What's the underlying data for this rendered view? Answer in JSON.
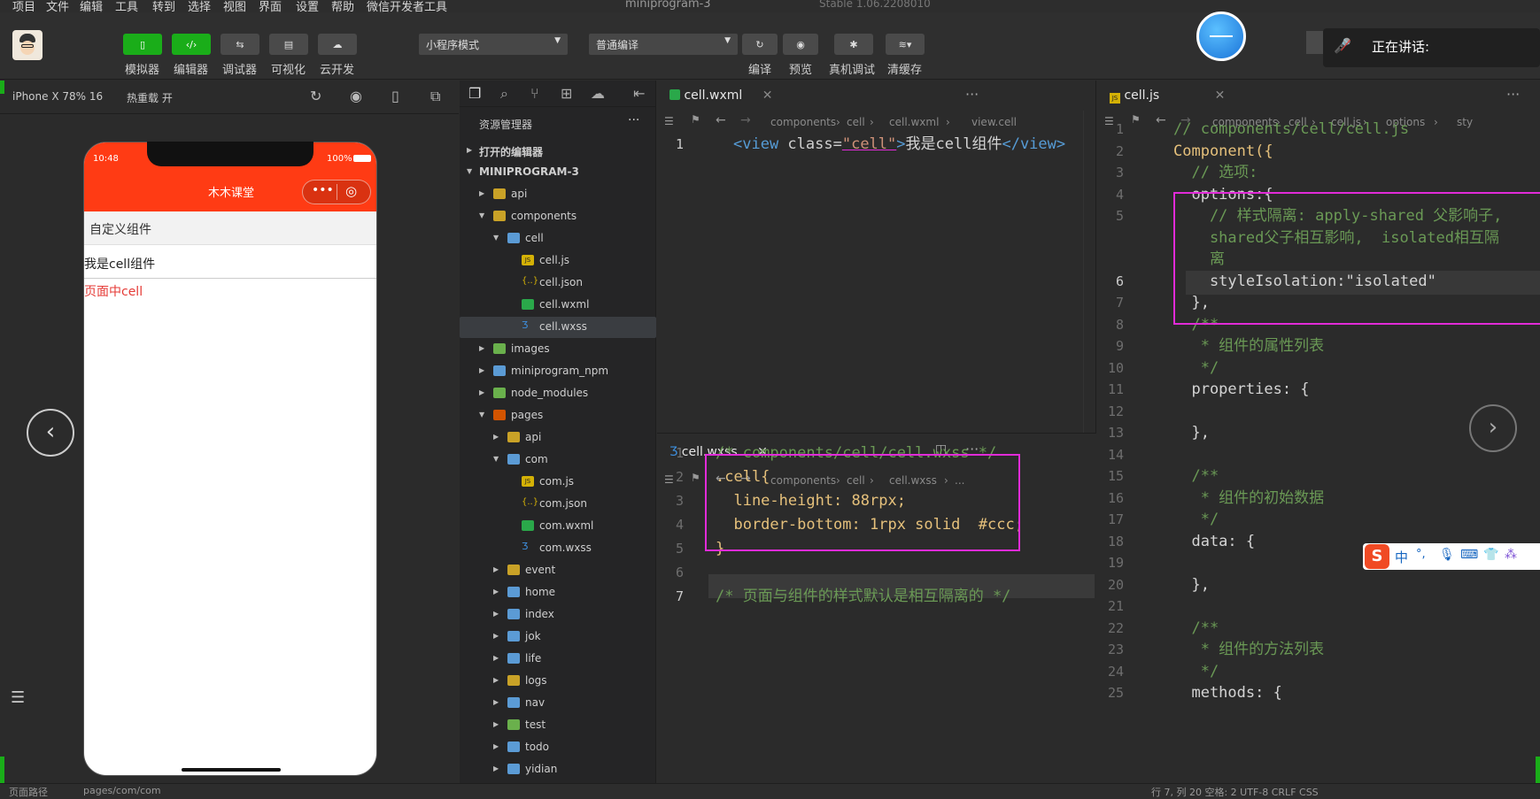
{
  "menu": [
    "项目",
    "文件",
    "编辑",
    "工具",
    "转到",
    "选择",
    "视图",
    "界面",
    "设置",
    "帮助",
    "微信开发者工具"
  ],
  "window_title": "miniprogram-3",
  "version_text": "Stable 1.06.2208010",
  "toolbar": {
    "buttons": [
      "模拟器",
      "编辑器",
      "调试器",
      "可视化",
      "云开发"
    ],
    "mode_select": "小程序模式",
    "compile_select": "普通编译",
    "actions": [
      "编译",
      "预览",
      "真机调试",
      "清缓存"
    ]
  },
  "speaking_label": "正在讲话:",
  "sim": {
    "device": "iPhone X 78% 16",
    "hot_reload": "热重载 开",
    "time": "10:48",
    "battery": "100%",
    "nav_title": "木木课堂",
    "row1": "自定义组件",
    "row2": "我是cell组件",
    "row3": "页面中cell"
  },
  "explorer": {
    "title": "资源管理器",
    "open_editors": "打开的编辑器",
    "project": "MINIPROGRAM-3",
    "items": [
      {
        "name": "api",
        "depth": 1,
        "type": "folder",
        "open": false
      },
      {
        "name": "components",
        "depth": 1,
        "type": "folder",
        "open": true
      },
      {
        "name": "cell",
        "depth": 2,
        "type": "folder-blue",
        "open": true
      },
      {
        "name": "cell.js",
        "depth": 3,
        "type": "js"
      },
      {
        "name": "cell.json",
        "depth": 3,
        "type": "json"
      },
      {
        "name": "cell.wxml",
        "depth": 3,
        "type": "wxml"
      },
      {
        "name": "cell.wxss",
        "depth": 3,
        "type": "wxss",
        "selected": true
      },
      {
        "name": "images",
        "depth": 1,
        "type": "folder-green",
        "open": false
      },
      {
        "name": "miniprogram_npm",
        "depth": 1,
        "type": "folder-blue",
        "open": false
      },
      {
        "name": "node_modules",
        "depth": 1,
        "type": "folder-green",
        "open": false
      },
      {
        "name": "pages",
        "depth": 1,
        "type": "folder-red",
        "open": true
      },
      {
        "name": "api",
        "depth": 2,
        "type": "folder",
        "open": false
      },
      {
        "name": "com",
        "depth": 2,
        "type": "folder-blue",
        "open": true
      },
      {
        "name": "com.js",
        "depth": 3,
        "type": "js"
      },
      {
        "name": "com.json",
        "depth": 3,
        "type": "json"
      },
      {
        "name": "com.wxml",
        "depth": 3,
        "type": "wxml"
      },
      {
        "name": "com.wxss",
        "depth": 3,
        "type": "wxss"
      },
      {
        "name": "event",
        "depth": 2,
        "type": "folder",
        "open": false
      },
      {
        "name": "home",
        "depth": 2,
        "type": "folder-blue",
        "open": false
      },
      {
        "name": "index",
        "depth": 2,
        "type": "folder-blue",
        "open": false
      },
      {
        "name": "jok",
        "depth": 2,
        "type": "folder-blue",
        "open": false
      },
      {
        "name": "life",
        "depth": 2,
        "type": "folder-blue",
        "open": false
      },
      {
        "name": "logs",
        "depth": 2,
        "type": "folder",
        "open": false
      },
      {
        "name": "nav",
        "depth": 2,
        "type": "folder-blue",
        "open": false
      },
      {
        "name": "test",
        "depth": 2,
        "type": "folder-green",
        "open": false
      },
      {
        "name": "todo",
        "depth": 2,
        "type": "folder-blue",
        "open": false
      },
      {
        "name": "yidian",
        "depth": 2,
        "type": "folder-blue",
        "open": false
      }
    ]
  },
  "editor1": {
    "tab": "cell.wxml",
    "crumbs": [
      "components",
      "cell",
      "cell.wxml",
      "view.cell"
    ],
    "line_no": "1",
    "code": {
      "open": "<view ",
      "attr": "class=",
      "val": "\"cell\"",
      "close": ">",
      "text": "我是cell组件",
      "end": "</view>"
    }
  },
  "editor2": {
    "tab": "cell.wxss",
    "crumbs": [
      "components",
      "cell",
      "cell.wxss",
      "..."
    ],
    "lines": [
      {
        "n": "1",
        "t": "/* components/cell/cell.wxss */",
        "c": "com"
      },
      {
        "n": "2",
        "t": ".cell{",
        "c": "kw"
      },
      {
        "n": "3",
        "t": "  line-height: 88rpx;",
        "c": "prop"
      },
      {
        "n": "4",
        "t": "  border-bottom: 1rpx solid  #ccc;",
        "c": "prop"
      },
      {
        "n": "5",
        "t": "}",
        "c": "kw"
      },
      {
        "n": "6",
        "t": "",
        "c": "plain"
      },
      {
        "n": "7",
        "t": "/* 页面与组件的样式默认是相互隔离的 */",
        "c": "com"
      }
    ]
  },
  "editor3": {
    "tab": "cell.js",
    "crumbs": [
      "components",
      "cell",
      "cell.js",
      "options",
      "sty"
    ],
    "lines": [
      {
        "n": "1",
        "t": "// components/cell/cell.js",
        "c": "com"
      },
      {
        "n": "2",
        "t": "Component({",
        "c": "kw"
      },
      {
        "n": "3",
        "t": "  // 选项:",
        "c": "com"
      },
      {
        "n": "4",
        "t": "  options:{",
        "c": "plain"
      },
      {
        "n": "5",
        "t": "    // 样式隔离: apply-shared 父影响子,",
        "c": "com"
      },
      {
        "n": "",
        "t": "    shared父子相互影响,  isolated相互隔",
        "c": "com"
      },
      {
        "n": "",
        "t": "    离",
        "c": "com"
      },
      {
        "n": "6",
        "t": "    styleIsolation:\"isolated\"",
        "c": "plain"
      },
      {
        "n": "7",
        "t": "  },",
        "c": "plain"
      },
      {
        "n": "8",
        "t": "  /**",
        "c": "com"
      },
      {
        "n": "9",
        "t": "   * 组件的属性列表",
        "c": "com"
      },
      {
        "n": "10",
        "t": "   */",
        "c": "com"
      },
      {
        "n": "11",
        "t": "  properties: {",
        "c": "plain"
      },
      {
        "n": "12",
        "t": "",
        "c": "plain"
      },
      {
        "n": "13",
        "t": "  },",
        "c": "plain"
      },
      {
        "n": "14",
        "t": "",
        "c": "plain"
      },
      {
        "n": "15",
        "t": "  /**",
        "c": "com"
      },
      {
        "n": "16",
        "t": "   * 组件的初始数据",
        "c": "com"
      },
      {
        "n": "17",
        "t": "   */",
        "c": "com"
      },
      {
        "n": "18",
        "t": "  data: {",
        "c": "plain"
      },
      {
        "n": "19",
        "t": "",
        "c": "plain"
      },
      {
        "n": "20",
        "t": "  },",
        "c": "plain"
      },
      {
        "n": "21",
        "t": "",
        "c": "plain"
      },
      {
        "n": "22",
        "t": "  /**",
        "c": "com"
      },
      {
        "n": "23",
        "t": "   * 组件的方法列表",
        "c": "com"
      },
      {
        "n": "24",
        "t": "   */",
        "c": "com"
      },
      {
        "n": "25",
        "t": "  methods: {",
        "c": "plain"
      }
    ]
  },
  "ime": [
    "中",
    "°,"
  ],
  "status": {
    "left": "页面路径",
    "path": "pages/com/com",
    "right": "行 7, 列 20  空格: 2  UTF-8  CRLF  CSS"
  },
  "colors": {
    "nav_red": "#ff3b14",
    "accent_green": "#1aad19",
    "highlight_magenta": "#e12bd8",
    "error_red": "#e53935"
  }
}
